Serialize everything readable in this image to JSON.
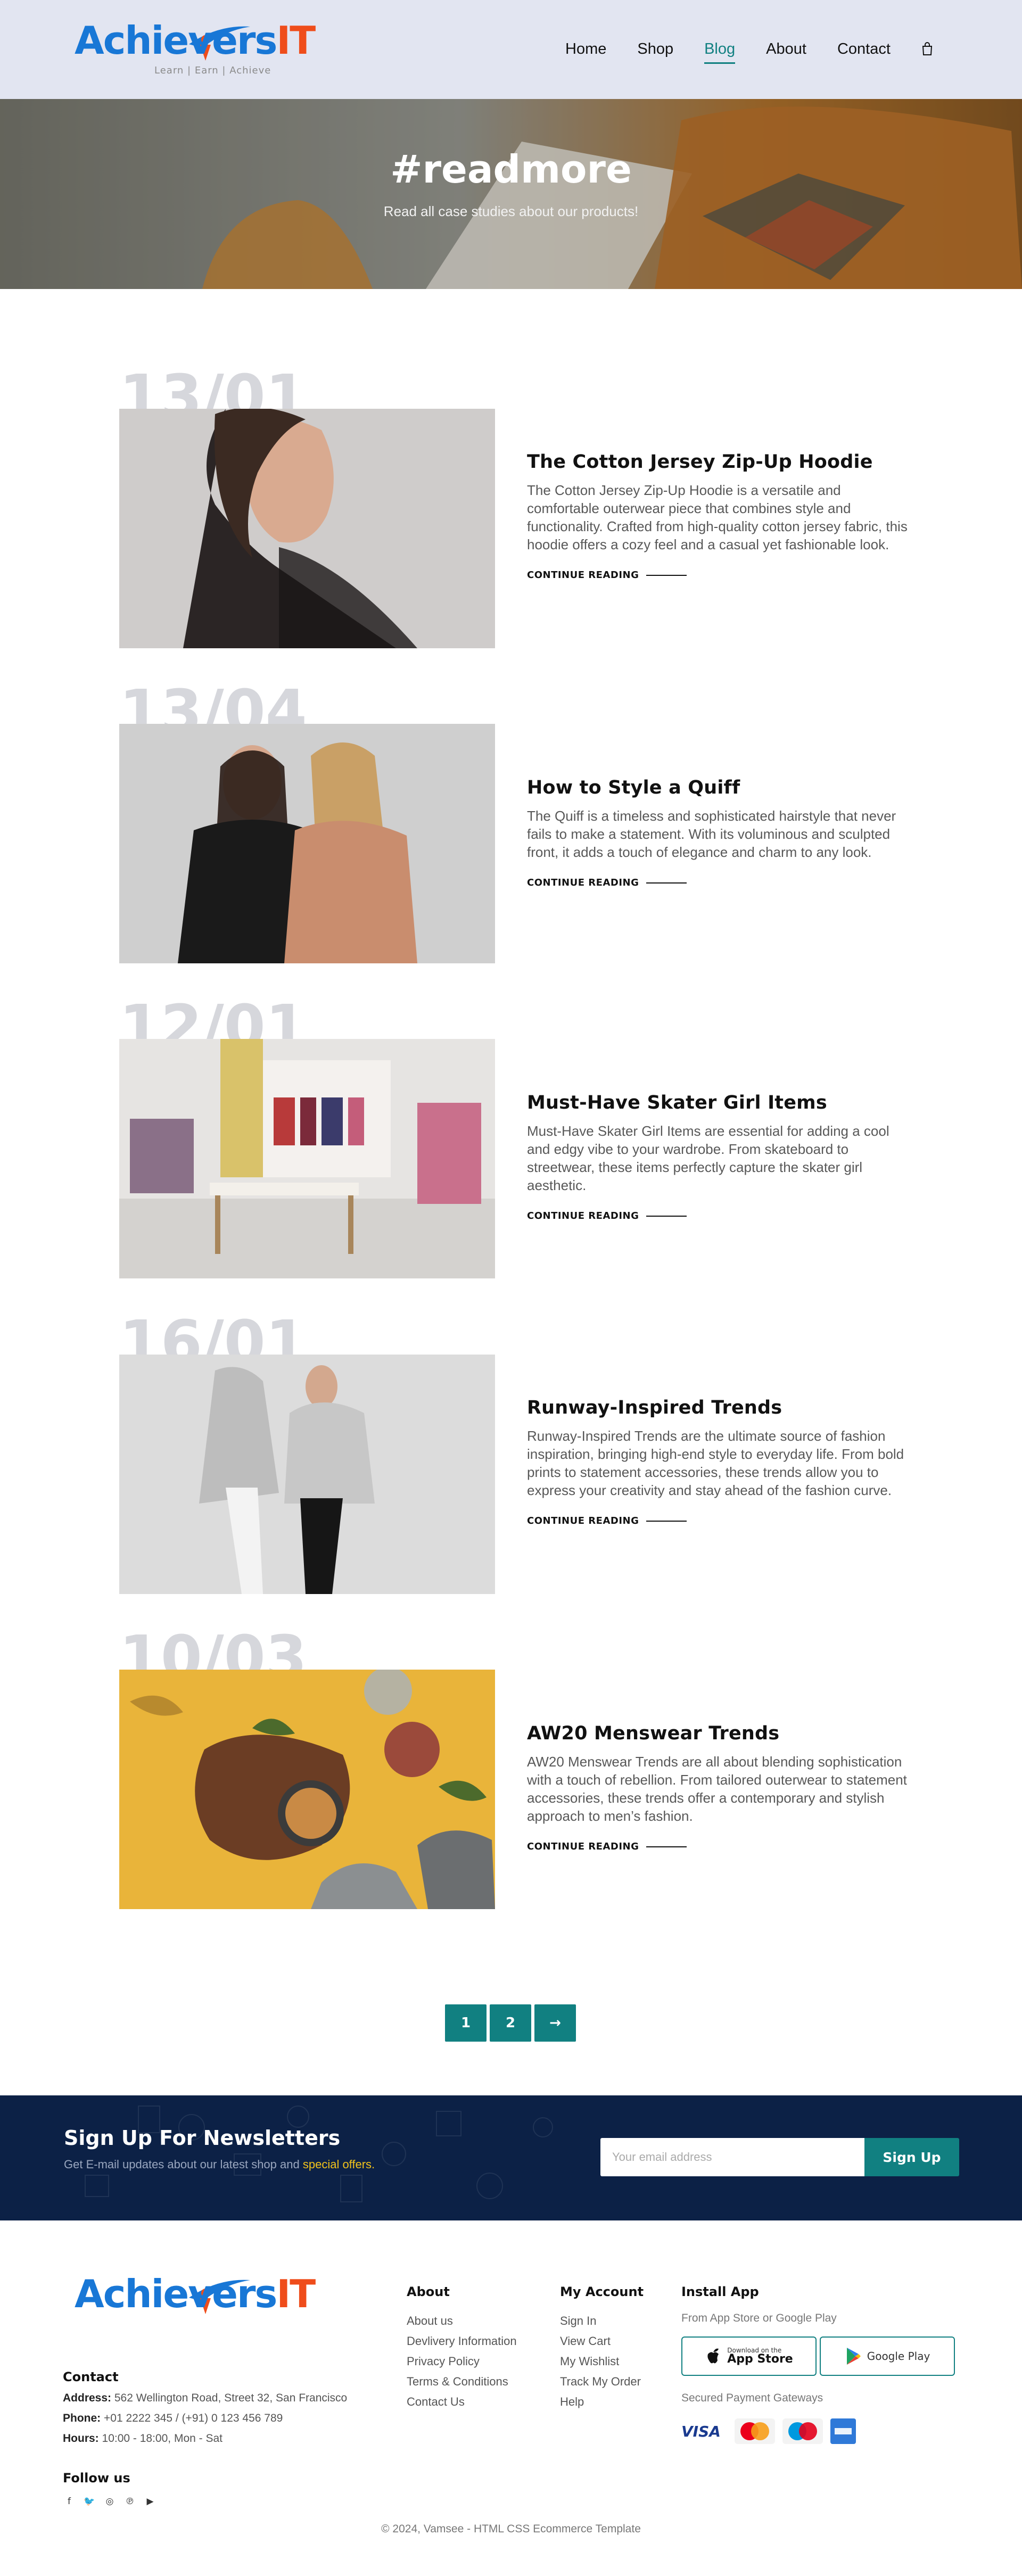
{
  "header": {
    "logo": {
      "part1": "Achievers",
      "part2": "IT",
      "tagline": "Learn | Earn | Achieve"
    },
    "nav": [
      {
        "label": "Home",
        "active": false
      },
      {
        "label": "Shop",
        "active": false
      },
      {
        "label": "Blog",
        "active": true
      },
      {
        "label": "About",
        "active": false
      },
      {
        "label": "Contact",
        "active": false
      }
    ],
    "cart_icon": "shopping-bag-icon",
    "accent": "#118081"
  },
  "hero": {
    "title": "#readmore",
    "subtitle": "Read all case studies about our products!"
  },
  "posts": [
    {
      "date": "13/01",
      "title": "The Cotton Jersey Zip-Up Hoodie",
      "excerpt": "The Cotton Jersey Zip-Up Hoodie is a versatile and comfortable outerwear piece that combines style and functionality. Crafted from high-quality cotton jersey fabric, this hoodie offers a cozy feel and a casual yet fashionable look.",
      "link": "CONTINUE READING"
    },
    {
      "date": "13/04",
      "title": "How to Style a Quiff",
      "excerpt": "The Quiff is a timeless and sophisticated hairstyle that never fails to make a statement. With its voluminous and sculpted front, it adds a touch of elegance and charm to any look.",
      "link": "CONTINUE READING"
    },
    {
      "date": "12/01",
      "title": "Must-Have Skater Girl Items",
      "excerpt": "Must-Have Skater Girl Items are essential for adding a cool and edgy vibe to your wardrobe. From skateboard to streetwear, these items perfectly capture the skater girl aesthetic.",
      "link": "CONTINUE READING"
    },
    {
      "date": "16/01",
      "title": "Runway-Inspired Trends",
      "excerpt": "Runway-Inspired Trends are the ultimate source of fashion inspiration, bringing high-end style to everyday life. From bold prints to statement accessories, these trends allow you to express your creativity and stay ahead of the fashion curve.",
      "link": "CONTINUE READING"
    },
    {
      "date": "10/03",
      "title": "AW20 Menswear Trends",
      "excerpt": "AW20 Menswear Trends are all about blending sophistication with a touch of rebellion. From tailored outerwear to statement accessories, these trends offer a contemporary and stylish approach to men’s fashion.",
      "link": "CONTINUE READING"
    }
  ],
  "pagination": {
    "pages": [
      "1",
      "2"
    ],
    "next": "→"
  },
  "newsletter": {
    "title": "Sign Up For Newsletters",
    "subtitle_pre": "Get E-mail updates about our latest shop and ",
    "subtitle_highlight": "special offers.",
    "placeholder": "Your email address",
    "button": "Sign Up"
  },
  "footer": {
    "contact": {
      "heading": "Contact",
      "address_label": "Address:",
      "address": "562 Wellington Road, Street 32, San Francisco",
      "phone_label": "Phone:",
      "phone": "+01 2222 345 / (+91) 0 123 456 789",
      "hours_label": "Hours:",
      "hours": "10:00 - 18:00, Mon - Sat"
    },
    "follow": {
      "heading": "Follow us",
      "icons": [
        "facebook-icon",
        "twitter-icon",
        "instagram-icon",
        "pinterest-icon",
        "youtube-icon"
      ]
    },
    "about": {
      "heading": "About",
      "links": [
        "About us",
        "Devlivery Information",
        "Privacy Policy",
        "Terms & Conditions",
        "Contact Us"
      ]
    },
    "account": {
      "heading": "My Account",
      "links": [
        "Sign In",
        "View Cart",
        "My Wishlist",
        "Track My Order",
        "Help"
      ]
    },
    "install": {
      "heading": "Install App",
      "subtitle": "From App Store or Google Play",
      "appstore_small": "Download on the",
      "appstore_big": "App Store",
      "googleplay": "Google Play",
      "payments_label": "Secured Payment Gateways",
      "payments": [
        "VISA",
        "MasterCard",
        "Maestro",
        "American Express"
      ]
    },
    "copyright": "© 2024, Vamsee - HTML CSS Ecommerce Template"
  }
}
